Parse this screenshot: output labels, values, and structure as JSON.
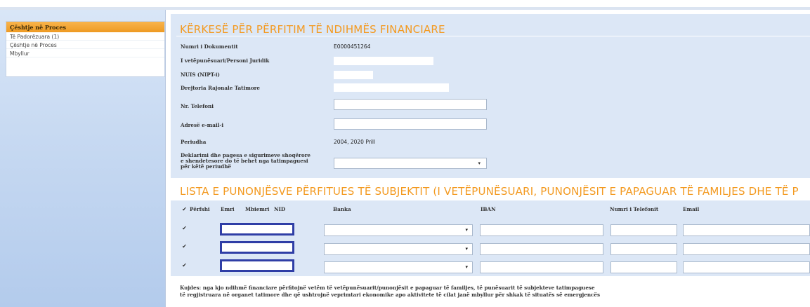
{
  "sidebar": {
    "header": "Çështje në Proces",
    "items": [
      "Të Padorëzuara (1)",
      "Çështje në Proces",
      "Mbyllur"
    ]
  },
  "form": {
    "title": "KËRKESË PËR PËRFITIM TË NDIHMËS FINANCIARE",
    "fields": {
      "doc_number_label": "Numri i Dokumentit",
      "doc_number_value": "E0000451264",
      "person_label": "I vetëpunësuari/Personi Juridik",
      "nuis_label": "NUIS (NIPT-i)",
      "directorate_label": "Drejtoria Rajonale Tatimore",
      "phone_label": "Nr. Telefoni",
      "email_label": "Adresë e-mail-i",
      "period_label": "Periudha",
      "period_value": "2004, 2020 Prill",
      "declaration_label_1": "Deklarimi dhe pagesa e sigurimeve shoqërore",
      "declaration_label_2": "e shendetesore do të behet nga tatimpaguesi",
      "declaration_label_3": "për këtë periudhë",
      "declaration_select_value": ""
    }
  },
  "employees": {
    "title": "LISTA E PUNONJËSVE PËRFITUES TË SUBJEKTIT (I VETËPUNËSUARI, PUNONJËSIT E PAPAGUAR TË FAMILJES DHE TË P",
    "columns": {
      "include": "Përfshi",
      "name": "Emri",
      "surname": "Mbiemri",
      "nid": "NID",
      "bank": "Banka",
      "iban": "IBAN",
      "phone": "Numri i Telefonit",
      "email": "Email"
    },
    "header_checkbox": "✔",
    "rows": [
      {
        "checked": "✔"
      },
      {
        "checked": "✔"
      },
      {
        "checked": "✔"
      }
    ]
  },
  "note": {
    "line1": "Kujdes: nga kjo ndihmë financiare përfitojnë vetëm të vetëpunësuarit/punonjësit e papaguar të familjes, të punësuarit të subjekteve tatimpaguese",
    "line2": "të regjistruara në organet tatimore dhe që ushtrojnë veprimtari ekonomike apo aktivitete të cilat janë mbyllur për shkak të situatës së emergjencës"
  },
  "colors": {
    "accent": "#f39a21",
    "section_bg": "#dce7f6",
    "highlight_border": "#2f3ea6"
  },
  "icons": {
    "dropdown": "chevron-down-icon",
    "check": "checkbox-checked-icon"
  },
  "dropdown_glyph": "▾"
}
